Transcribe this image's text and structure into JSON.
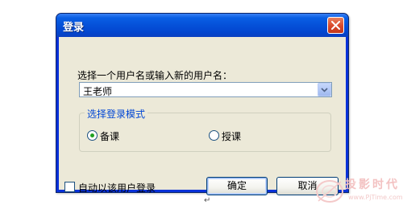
{
  "dialog": {
    "title": "登录",
    "choose_label": "选择一个用户名或输入新的用户名：",
    "username_value": "王老师",
    "group_title": "选择登录模式",
    "modes": [
      {
        "label": "备课",
        "selected": true
      },
      {
        "label": "授课",
        "selected": false
      }
    ],
    "auto_login_label": "自动以该用户登录",
    "auto_login_checked": false,
    "ok_label": "确定",
    "cancel_label": "取消"
  },
  "page": {
    "below_mark": "↵",
    "watermark_text": "投影时代",
    "watermark_url": "www.PjTime.com"
  },
  "colors": {
    "titlebar": "#0550d8",
    "client": "#ece9d8",
    "group_title": "#0046d5",
    "radio_dot": "#21a121",
    "close_button": "#d9482a"
  },
  "icons": {
    "close": "close-icon",
    "dropdown": "chevron-down-icon"
  }
}
